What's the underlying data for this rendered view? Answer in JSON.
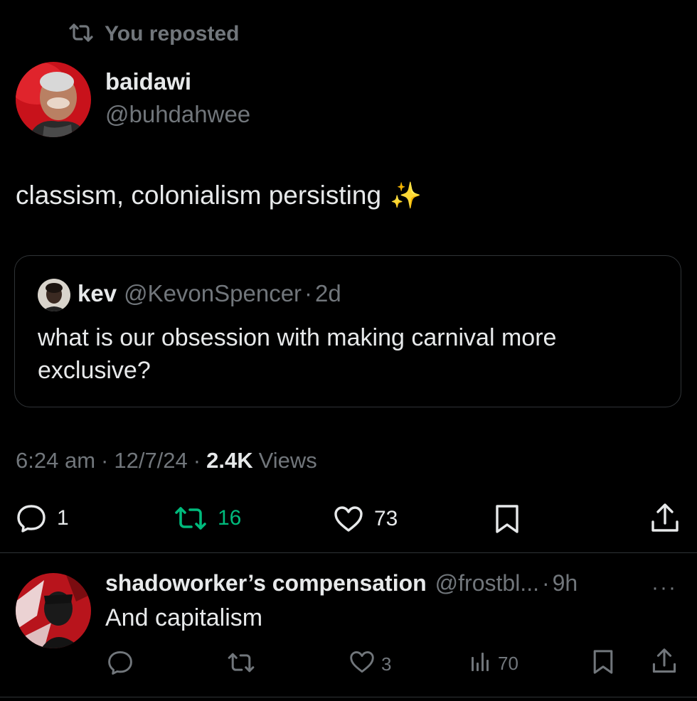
{
  "repost_header": {
    "icon": "repost-icon",
    "text": "You reposted"
  },
  "tweet": {
    "author_name": "baidawi",
    "author_handle": "@buhdahwee",
    "text": "classism, colonialism persisting",
    "emoji": "✨",
    "quote": {
      "author_name": "kev",
      "author_handle": "@KevonSpencer",
      "separator": "·",
      "age": "2d",
      "text": "what is our obsession with making carnival more exclusive?"
    },
    "time": "6:24 am",
    "date": "12/7/24",
    "separator": "·",
    "views_count": "2.4K",
    "views_label": "Views",
    "actions": {
      "replies": "1",
      "reposts": "16",
      "likes": "73"
    },
    "colors": {
      "repost_active": "#00ba7c",
      "muted": "#71767b",
      "text": "#e7e9ea",
      "background": "#000000",
      "border": "#2f3336"
    }
  },
  "reply": {
    "author_name": "shadoworker’s compensation",
    "author_handle": "@frostbl...",
    "separator": "·",
    "age": "9h",
    "more": "···",
    "text": "And capitalism",
    "actions": {
      "likes": "3",
      "views": "70"
    }
  }
}
